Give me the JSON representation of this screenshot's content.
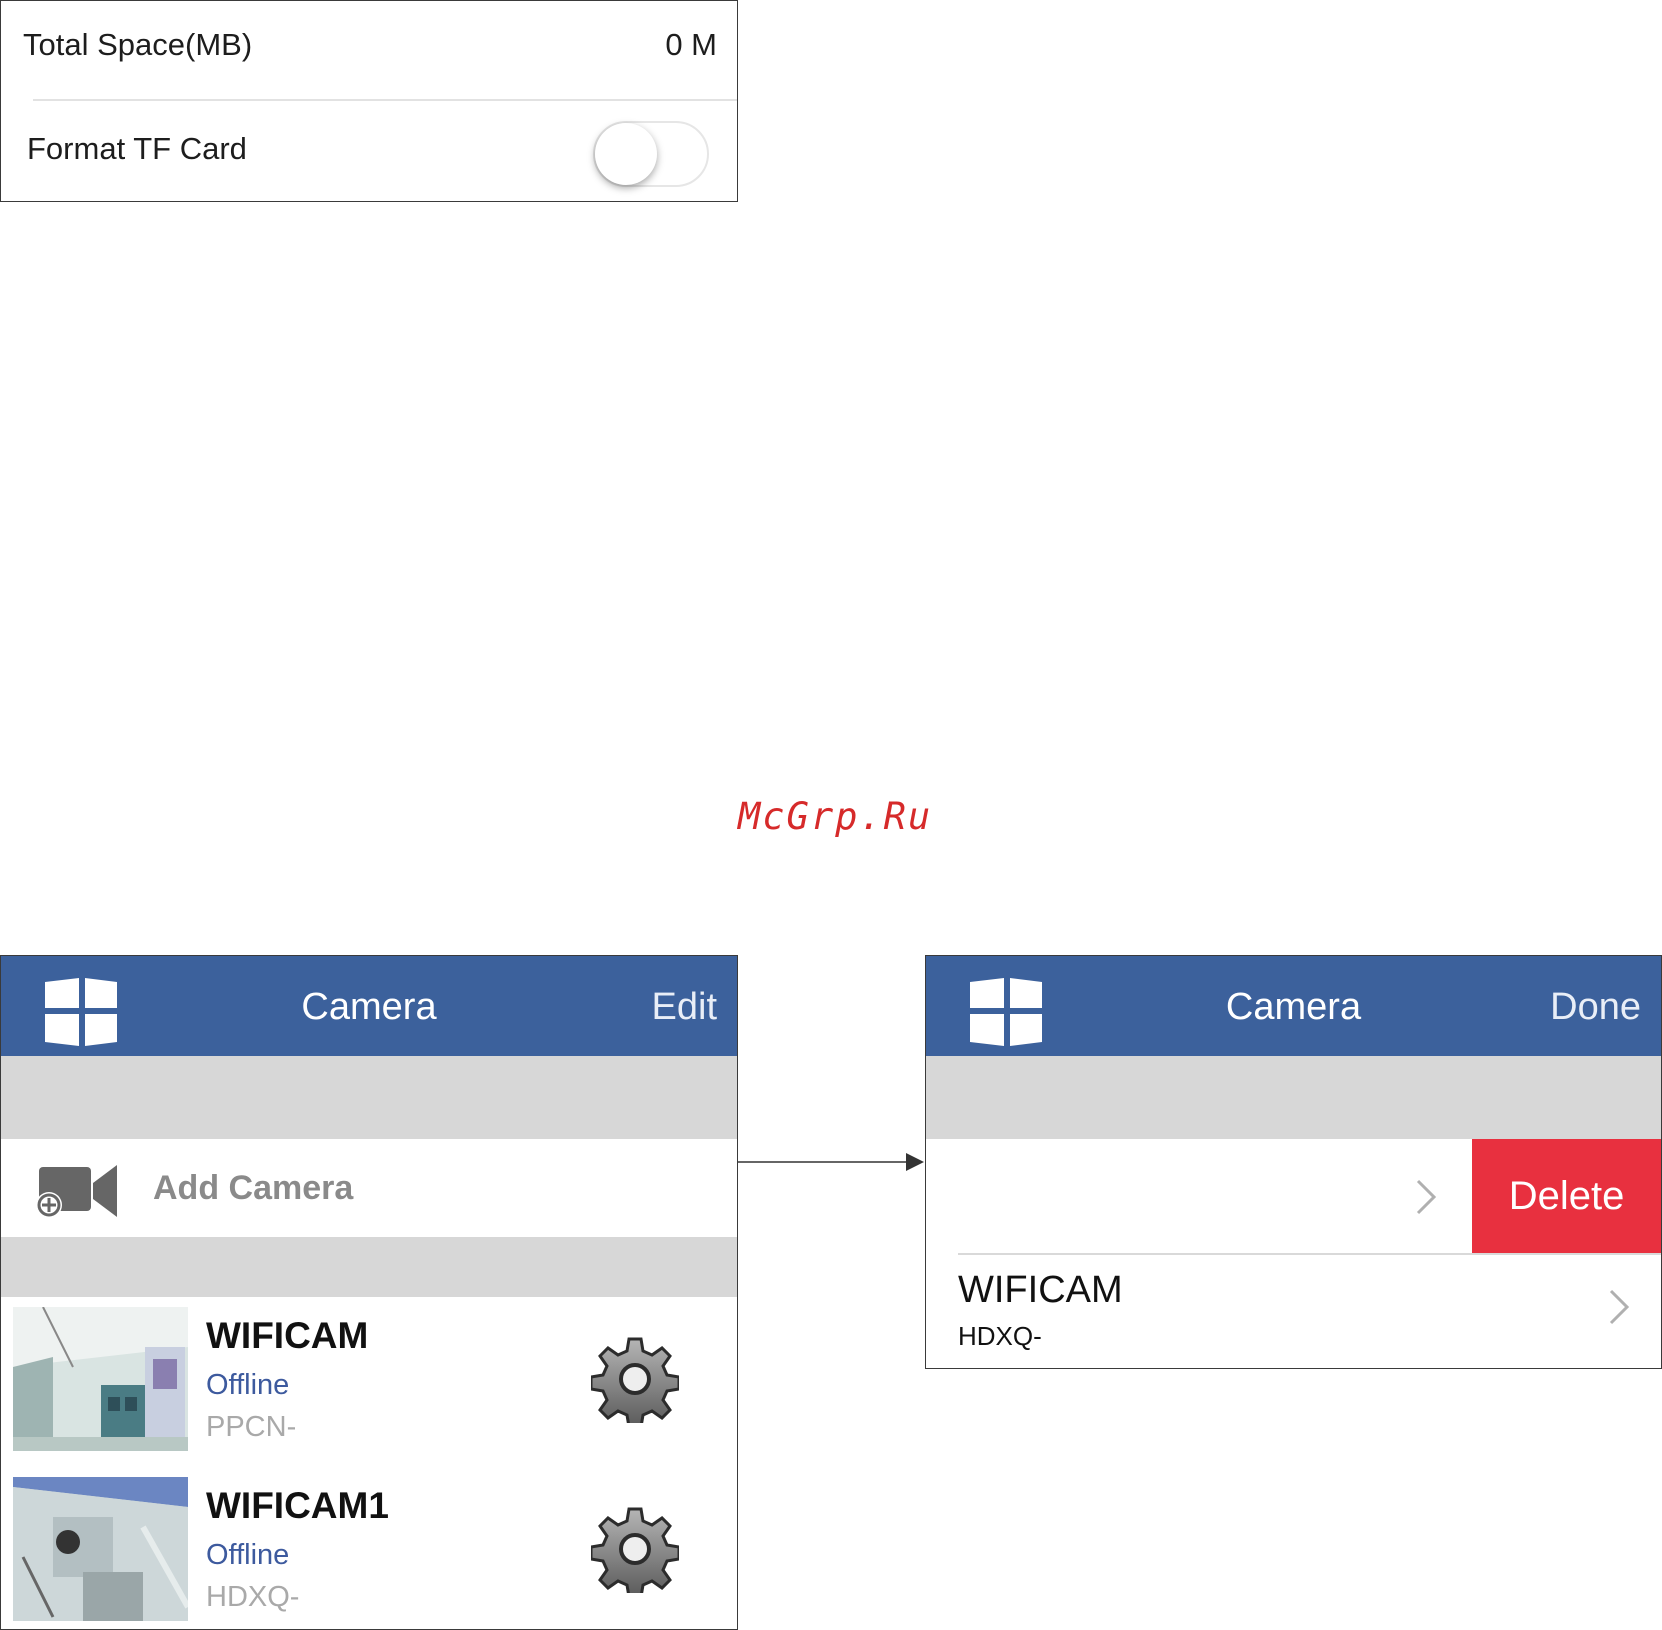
{
  "storage_settings": {
    "total_space_label": "Total Space(MB)",
    "total_space_value": "0 M",
    "format_label": "Format TF Card",
    "format_toggle_on": false
  },
  "watermark": "McGrp.Ru",
  "camera_list_screen": {
    "title": "Camera",
    "right_button": "Edit",
    "add_camera_label": "Add Camera",
    "cameras": [
      {
        "name": "WIFICAM",
        "status": "Offline",
        "uid": "PPCN-"
      },
      {
        "name": "WIFICAM1",
        "status": "Offline",
        "uid": "HDXQ-"
      }
    ]
  },
  "camera_edit_screen": {
    "title": "Camera",
    "right_button": "Done",
    "delete_label": "Delete",
    "rows": [
      {
        "name": "",
        "uid": ""
      },
      {
        "name": "WIFICAM",
        "uid": "HDXQ-"
      }
    ]
  },
  "colors": {
    "navbar": "#3c619c",
    "delete": "#e8303f",
    "status_text": "#3d5a9e",
    "watermark": "#d62a2a"
  }
}
